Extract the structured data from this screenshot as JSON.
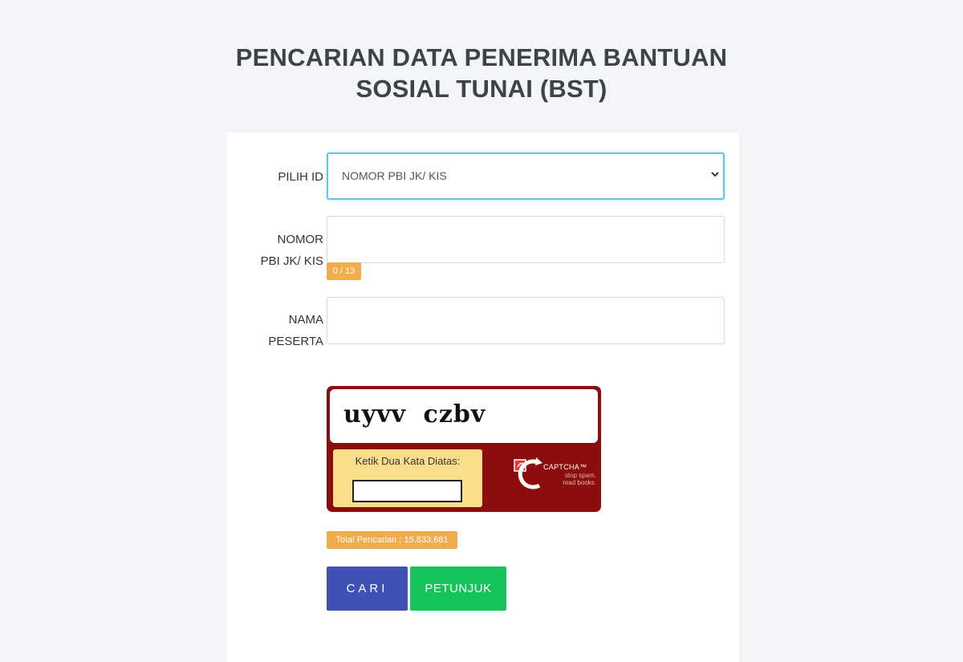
{
  "header": {
    "title_line1": "PENCARIAN DATA PENERIMA BANTUAN",
    "title_line2": "SOSIAL TUNAI (BST)"
  },
  "form": {
    "id_select": {
      "label": "PILIH ID",
      "selected_value": "NOMOR PBI JK/ KIS",
      "icon": "chevron-down-icon"
    },
    "id_number": {
      "label_line1": "NOMOR",
      "label_line2": "PBI JK/ KIS",
      "value": "",
      "counter": "0 / 13"
    },
    "participant_name": {
      "label_line1": "NAMA",
      "label_line2": "PESERTA",
      "value": ""
    }
  },
  "captcha": {
    "words": "uyvv  czbv",
    "instruction": "Ketik Dua Kata Diatas:",
    "input_value": "",
    "logo_text": "CAPTCHA™",
    "tagline_line1": "stop spam.",
    "tagline_line2": "read books.",
    "brand_color": "#8b0d0d"
  },
  "stats": {
    "total_label": "Total Pencarian : 15.833.681"
  },
  "actions": {
    "search_label": "CARI",
    "help_label": "PETUNJUK",
    "search_color": "#3f51b5",
    "help_color": "#14c35a"
  }
}
